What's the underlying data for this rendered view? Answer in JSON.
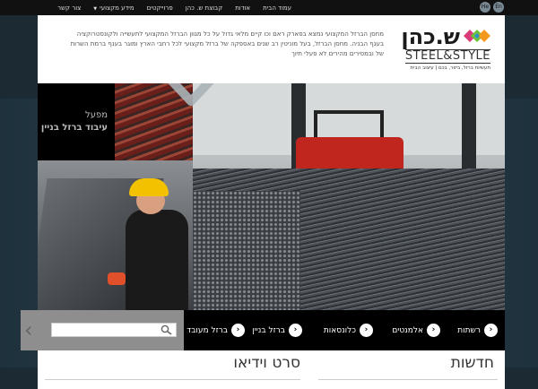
{
  "topnav": {
    "items": [
      {
        "label": "עמוד הבית"
      },
      {
        "label": "אודות"
      },
      {
        "label": "קבוצת ש. כהן"
      },
      {
        "label": "פרוייקטים"
      },
      {
        "label": "מידע מקצועי"
      },
      {
        "label": "צור קשר"
      }
    ],
    "lang_he": "He",
    "lang_en": "En"
  },
  "logo": {
    "hebrew": "ש.כהן",
    "english": "STEEL&STYLE",
    "tagline": "תעשיות ברזל, ביזור, בכם | עיצוב הבית"
  },
  "intro": {
    "text": "מחסן הברזל המקצועי נמצא בפארק ראם וכו קיים מלאי גדול על כל מגוון הברזל המקצועי לתעשייה ולקונסטרוקציה בענף הבניה. מחסן הברזל, בעל מוניטין רב שנים באספקה של ברזל מקצועי לכל רחבי הארץ ומוגר בענף ברמת השרות של ובמסירים מהירים לא פעלי תיוך"
  },
  "hero": {
    "tile_line1": "מפעל",
    "tile_line2": "עיבוד ברזל בניין"
  },
  "categories": [
    {
      "label": "רשתות"
    },
    {
      "label": "אלמנטים"
    },
    {
      "label": "כלונסאות"
    },
    {
      "label": "ברזל בניין"
    },
    {
      "label": "ברזל מעובד"
    }
  ],
  "search": {
    "placeholder": ""
  },
  "sections": {
    "news_title": "חדשות",
    "video_title": "סרט וידיאו"
  },
  "colors": {
    "topbar": "#111111",
    "page_bg": "#1b2a33",
    "logo_green": "#6cbf3a",
    "logo_pink": "#d93a7a",
    "logo_orange": "#f39a1e",
    "logo_blue": "#2d8fd0"
  }
}
